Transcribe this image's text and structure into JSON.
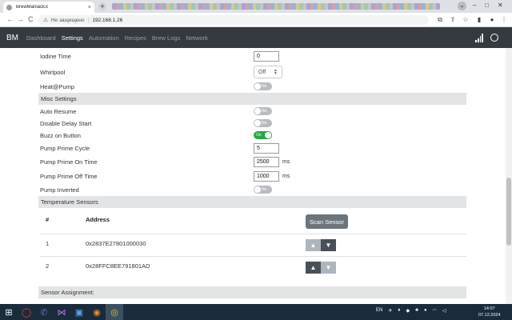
{
  "browser": {
    "tab_title": "BrewManiacEx",
    "tab_close": "×",
    "new_tab": "+",
    "nav_back": "←",
    "nav_forward": "→",
    "reload": "C",
    "security_label": "Не защищено",
    "separator": "|",
    "url": "192.168.1.26",
    "menu_icon": "⋮"
  },
  "appnav": {
    "brand": "BM",
    "links": [
      "Dashboard",
      "Settings",
      "Automation",
      "Recipes",
      "Brew Logs",
      "Network"
    ],
    "active": "Settings"
  },
  "settings": {
    "iodine_time": {
      "label": "Iodine Time",
      "value": "0"
    },
    "whirlpool": {
      "label": "Whirlpool",
      "value": "Off"
    },
    "heat_pump": {
      "label": "Heat@Pump",
      "state": "No"
    },
    "misc_header": "Misc Settings",
    "auto_resume": {
      "label": "Auto Resume",
      "state": "No"
    },
    "disable_delay_start": {
      "label": "Disable Delay Start",
      "state": "No"
    },
    "buzz_on_button": {
      "label": "Buzz on Button",
      "state": "On"
    },
    "pump_prime_cycle": {
      "label": "Pump Prime Cycle",
      "value": "5"
    },
    "pump_prime_on_time": {
      "label": "Pump Prime On Time",
      "value": "2500",
      "unit": "ms"
    },
    "pump_prime_off_time": {
      "label": "Pump Prime Off Time",
      "value": "1000",
      "unit": "ms"
    },
    "pump_inverted": {
      "label": "Pump Inverted",
      "state": "No"
    }
  },
  "sensors": {
    "header": "Temperature Sensors",
    "col_num": "#",
    "col_address": "Address",
    "scan_button": "Scan Sensor",
    "rows": [
      {
        "num": "1",
        "address": "0x2837E27801000030"
      },
      {
        "num": "2",
        "address": "0x28FFC8EE791801AD"
      }
    ],
    "up_arrow": "▲",
    "down_arrow": "▼"
  },
  "sensor_assignment_header": "Sensor Assignment:",
  "taskbar": {
    "lang": "EN",
    "time": "14:07",
    "date": "07.12.2024"
  }
}
